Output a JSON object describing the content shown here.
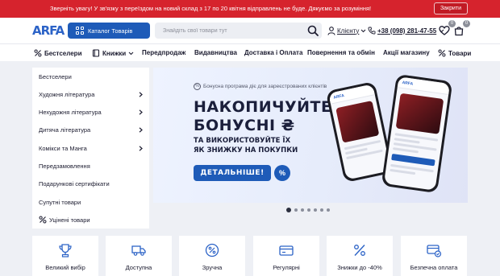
{
  "notice": {
    "text": "Зверніть увагу! У зв'язку з переїздом на новий склад з 17 по 20 квітня відправлень не буде. Дякуємо за розуміння!",
    "close_label": "Закрити"
  },
  "header": {
    "logo_a": "A",
    "logo_rest": "RFA",
    "catalog_label": "Каталог Товарів",
    "search_placeholder": "Знайдіть свої товари тут",
    "client_label": "Клієнту",
    "phone": "+38 (098) 281-47-55",
    "wishlist_count": "0",
    "cart_count": "0"
  },
  "nav": {
    "items": [
      {
        "label": "Бестселери",
        "icon": "percent-icon"
      },
      {
        "label": "Книжки",
        "icon": "book-icon"
      },
      {
        "label": "Передпродаж"
      },
      {
        "label": "Видавництва"
      },
      {
        "label": "Доставка і Оплата"
      },
      {
        "label": "Повернення та обмін"
      },
      {
        "label": "Акції магазину"
      },
      {
        "label": "Товари",
        "icon": "percent-icon"
      }
    ]
  },
  "sidebar": {
    "items": [
      {
        "label": "Бестселери",
        "arrow": false
      },
      {
        "label": "Художня література",
        "arrow": true
      },
      {
        "label": "Нехудожня література",
        "arrow": true
      },
      {
        "label": "Дитяча література",
        "arrow": true
      },
      {
        "label": "Комікси та Манга",
        "arrow": true
      },
      {
        "label": "Передзамовлення",
        "arrow": false
      },
      {
        "label": "Подарункові сертифікати",
        "arrow": false
      },
      {
        "label": "Супутні товари",
        "arrow": false
      },
      {
        "label": "Уцінені товари",
        "arrow": false,
        "icon": "percent-icon"
      }
    ]
  },
  "banner": {
    "bonus_note": "Бонусна програма діє для зареєстрованих клієнтів",
    "headline_1": "НАКОПИЧУЙТЕ",
    "headline_2": "БОНУСНІ ₴",
    "sub_1": "ТА ВИКОРИСТОВУЙТЕ ЇХ",
    "sub_2": "ЯК ЗНИЖКУ НА ПОКУПКИ",
    "button_label": "ДЕТАЛЬНІШЕ!",
    "pct_symbol": "%",
    "phone_brand": "ARFA",
    "slides": 7,
    "active_slide": 0
  },
  "features": [
    {
      "label": "Великий вибір",
      "icon": "trophy-icon"
    },
    {
      "label": "Доступна",
      "icon": "truck-icon"
    },
    {
      "label": "Зручна",
      "icon": "percent-icon"
    },
    {
      "label": "Регулярні",
      "icon": "card-icon"
    },
    {
      "label": "Знижки до -40%",
      "icon": "percent-icon"
    },
    {
      "label": "Безпечна оплата",
      "icon": "secure-payment-icon"
    }
  ],
  "colors": {
    "notice_bg": "#d6232d",
    "brand_blue": "#1e5bb8"
  }
}
